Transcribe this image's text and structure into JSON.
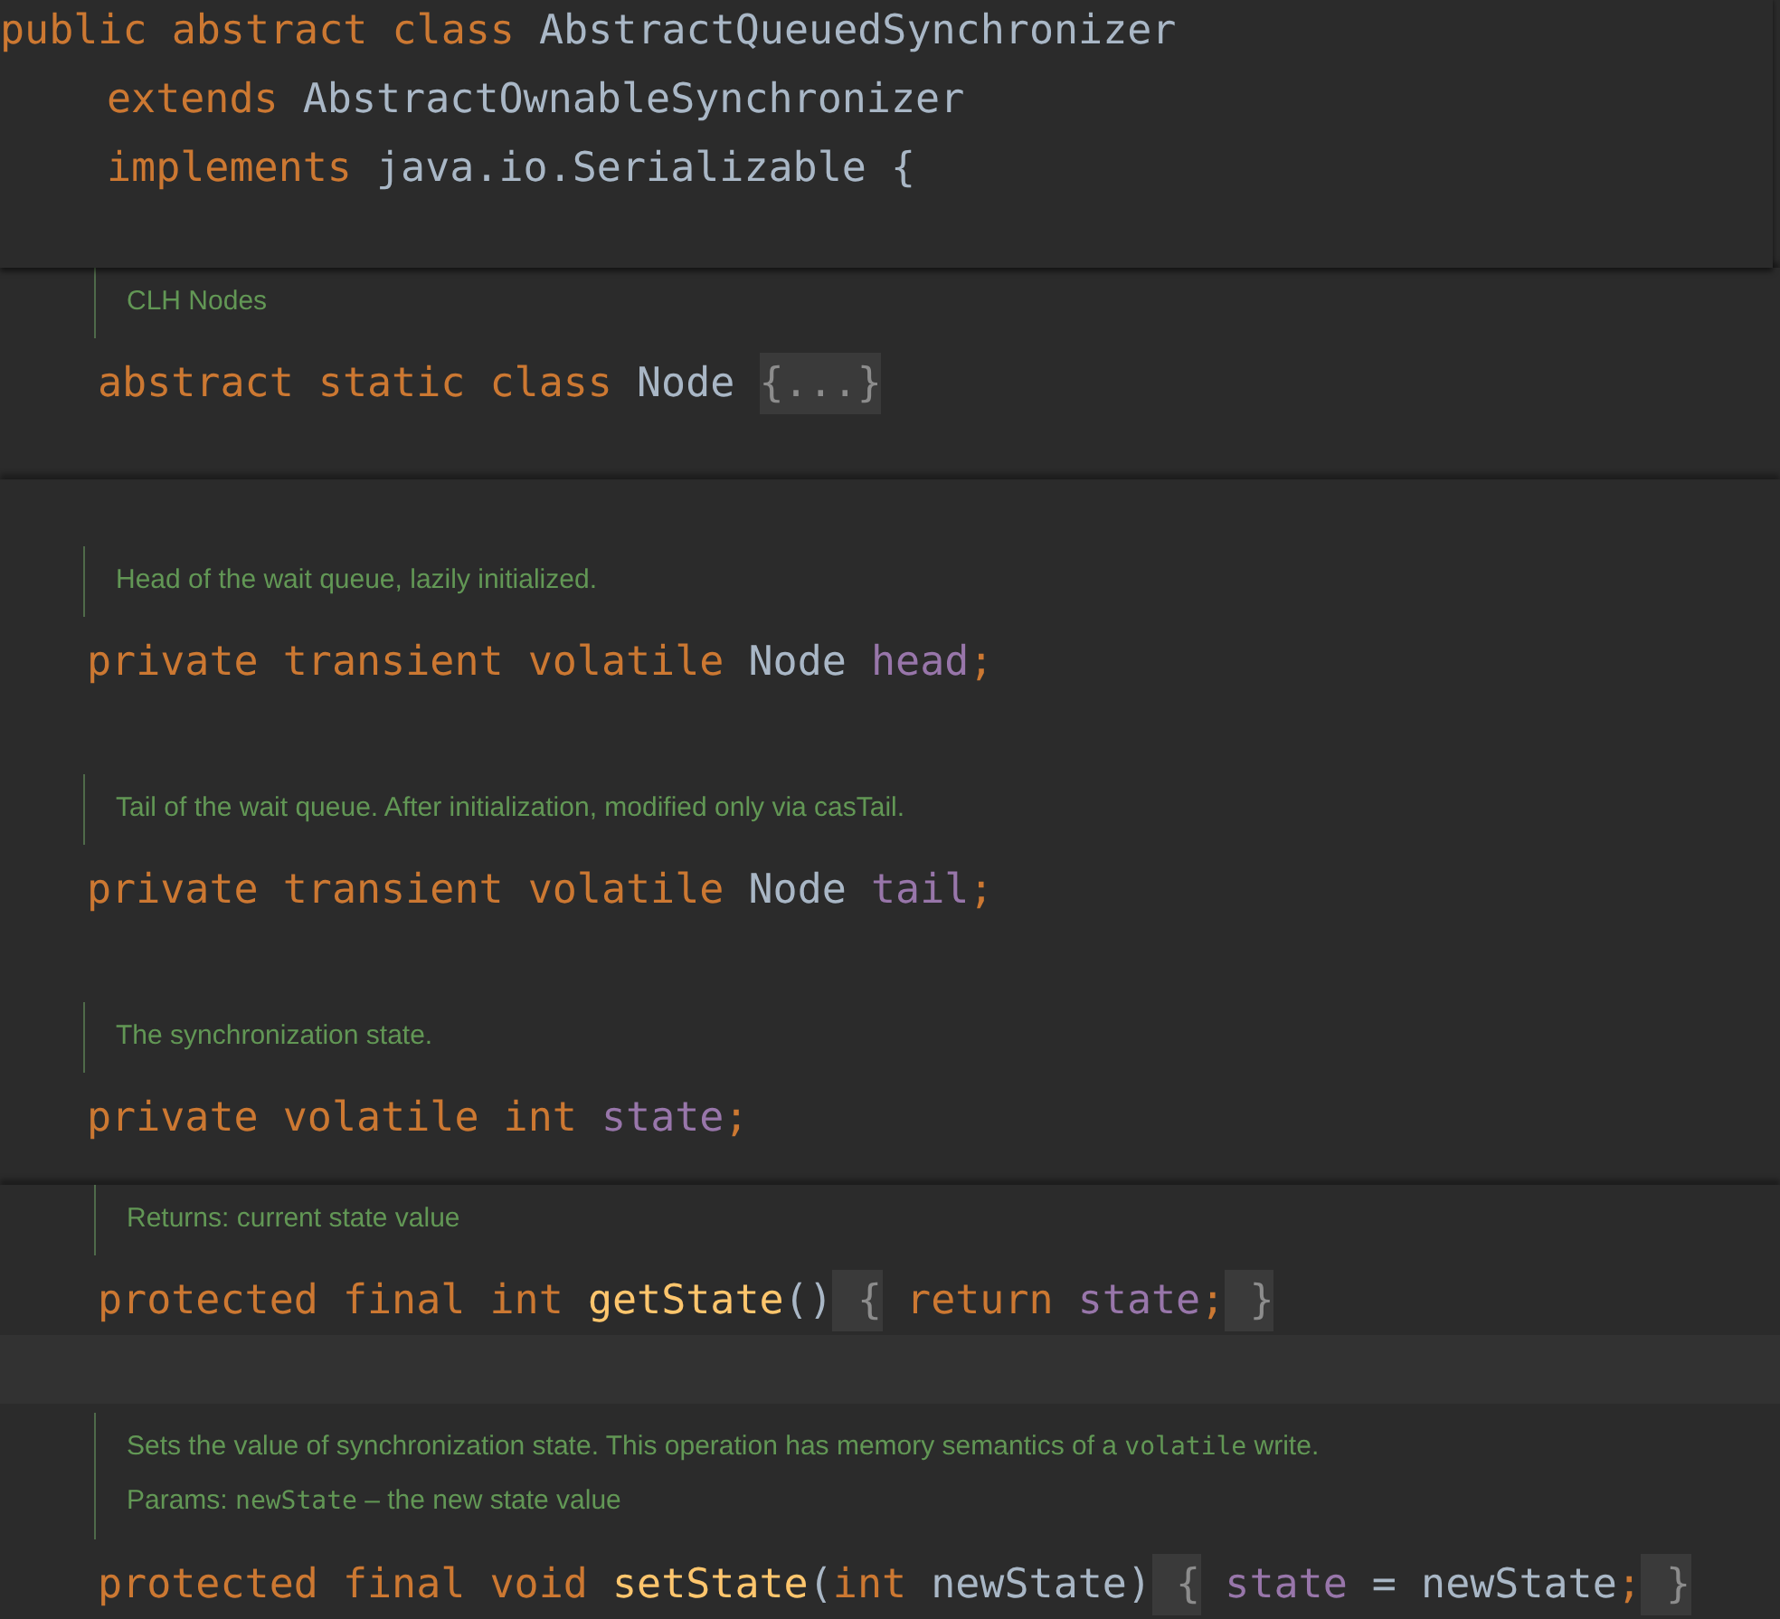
{
  "header": {
    "lines": [
      [
        {
          "t": "public abstract class ",
          "kind": "keyword"
        },
        {
          "t": "AbstractQueuedSynchronizer",
          "kind": "plain"
        }
      ],
      [
        {
          "t": "extends ",
          "kind": "keyword"
        },
        {
          "t": "AbstractOwnableSynchronizer",
          "kind": "plain"
        }
      ],
      [
        {
          "t": "implements ",
          "kind": "keyword"
        },
        {
          "t": "java.io.Serializable {",
          "kind": "plain"
        }
      ]
    ]
  },
  "sections": [
    {
      "items": [
        {
          "kind": "member",
          "doc": [
            [
              {
                "t": "CLH Nodes",
                "kind": "text"
              }
            ]
          ],
          "code": [
            {
              "t": "abstract static class ",
              "kind": "keyword"
            },
            {
              "t": "Node ",
              "kind": "plain"
            },
            {
              "t": "{...}",
              "kind": "fold"
            }
          ]
        }
      ]
    },
    {
      "items": [
        {
          "kind": "member",
          "doc": [
            [
              {
                "t": "Head of the wait queue, lazily initialized.",
                "kind": "text"
              }
            ]
          ],
          "code": [
            {
              "t": "private transient volatile ",
              "kind": "keyword"
            },
            {
              "t": "Node ",
              "kind": "plain"
            },
            {
              "t": "head",
              "kind": "field"
            },
            {
              "t": ";",
              "kind": "keyword"
            }
          ]
        },
        {
          "kind": "member",
          "doc": [
            [
              {
                "t": "Tail of the wait queue. After initialization, modified only via casTail.",
                "kind": "text"
              }
            ]
          ],
          "code": [
            {
              "t": "private transient volatile ",
              "kind": "keyword"
            },
            {
              "t": "Node ",
              "kind": "plain"
            },
            {
              "t": "tail",
              "kind": "field"
            },
            {
              "t": ";",
              "kind": "keyword"
            }
          ]
        },
        {
          "kind": "member",
          "doc": [
            [
              {
                "t": "The synchronization state.",
                "kind": "text"
              }
            ]
          ],
          "code": [
            {
              "t": "private volatile int ",
              "kind": "keyword"
            },
            {
              "t": "state",
              "kind": "field"
            },
            {
              "t": ";",
              "kind": "keyword"
            }
          ]
        }
      ]
    },
    {
      "items": [
        {
          "kind": "member",
          "doc": [
            [
              {
                "t": "Returns:  current state value",
                "kind": "text"
              }
            ]
          ],
          "code": [
            {
              "t": "protected final int ",
              "kind": "keyword"
            },
            {
              "t": "getState",
              "kind": "method"
            },
            {
              "t": "()",
              "kind": "plain"
            },
            {
              "t": " {",
              "kind": "fold"
            },
            {
              "t": " return ",
              "kind": "keyword"
            },
            {
              "t": "state",
              "kind": "field"
            },
            {
              "t": ";",
              "kind": "keyword"
            },
            {
              "t": " }",
              "kind": "fold"
            }
          ]
        },
        {
          "kind": "current-line"
        },
        {
          "kind": "member",
          "doc": [
            [
              {
                "t": "Sets the value of synchronization state. This operation has memory semantics of a ",
                "kind": "text"
              },
              {
                "t": "volatile",
                "kind": "code"
              },
              {
                "t": " write.",
                "kind": "text"
              }
            ],
            [
              {
                "t": "Params: ",
                "kind": "text"
              },
              {
                "t": "newState",
                "kind": "code"
              },
              {
                "t": " – the new state value",
                "kind": "text"
              }
            ]
          ],
          "code": [
            {
              "t": "protected final void ",
              "kind": "keyword"
            },
            {
              "t": "setState",
              "kind": "method"
            },
            {
              "t": "(",
              "kind": "plain"
            },
            {
              "t": "int ",
              "kind": "keyword"
            },
            {
              "t": "newState)",
              "kind": "plain"
            },
            {
              "t": " {",
              "kind": "fold"
            },
            {
              "t": " state",
              "kind": "field"
            },
            {
              "t": " = newState",
              "kind": "plain"
            },
            {
              "t": ";",
              "kind": "keyword"
            },
            {
              "t": " }",
              "kind": "fold"
            }
          ]
        }
      ]
    }
  ]
}
